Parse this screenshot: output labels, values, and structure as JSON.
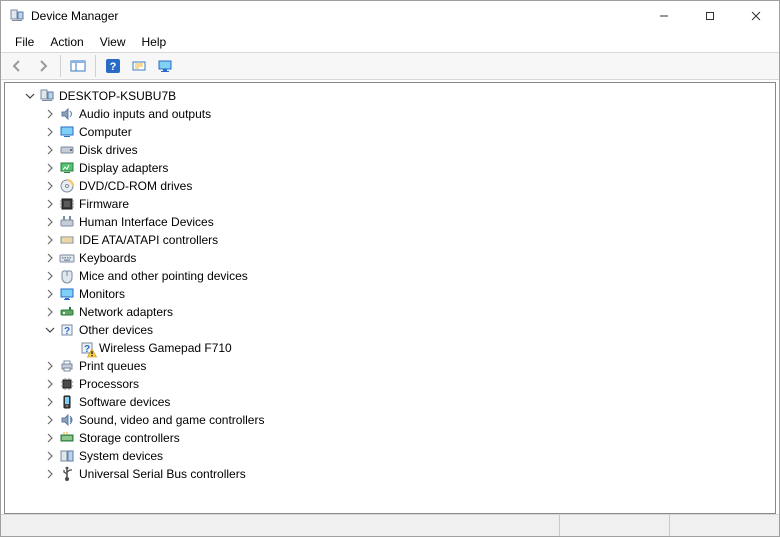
{
  "titlebar": {
    "title": "Device Manager"
  },
  "menu": {
    "file": "File",
    "action": "Action",
    "view": "View",
    "help": "Help"
  },
  "tree": {
    "root": "DESKTOP-KSUBU7B",
    "categories": [
      {
        "id": "audio",
        "label": "Audio inputs and outputs",
        "expanded": false
      },
      {
        "id": "computer",
        "label": "Computer",
        "expanded": false
      },
      {
        "id": "diskdrives",
        "label": "Disk drives",
        "expanded": false
      },
      {
        "id": "display",
        "label": "Display adapters",
        "expanded": false
      },
      {
        "id": "dvd",
        "label": "DVD/CD-ROM drives",
        "expanded": false
      },
      {
        "id": "firmware",
        "label": "Firmware",
        "expanded": false
      },
      {
        "id": "hid",
        "label": "Human Interface Devices",
        "expanded": false
      },
      {
        "id": "ide",
        "label": "IDE ATA/ATAPI controllers",
        "expanded": false
      },
      {
        "id": "keyboards",
        "label": "Keyboards",
        "expanded": false
      },
      {
        "id": "mice",
        "label": "Mice and other pointing devices",
        "expanded": false
      },
      {
        "id": "monitors",
        "label": "Monitors",
        "expanded": false
      },
      {
        "id": "network",
        "label": "Network adapters",
        "expanded": false
      },
      {
        "id": "other",
        "label": "Other devices",
        "expanded": true,
        "children": [
          {
            "id": "gamepad",
            "label": "Wireless Gamepad F710",
            "warning": true
          }
        ]
      },
      {
        "id": "printqueues",
        "label": "Print queues",
        "expanded": false
      },
      {
        "id": "processors",
        "label": "Processors",
        "expanded": false
      },
      {
        "id": "software",
        "label": "Software devices",
        "expanded": false
      },
      {
        "id": "sound",
        "label": "Sound, video and game controllers",
        "expanded": false
      },
      {
        "id": "storage",
        "label": "Storage controllers",
        "expanded": false
      },
      {
        "id": "system",
        "label": "System devices",
        "expanded": false
      },
      {
        "id": "usb",
        "label": "Universal Serial Bus controllers",
        "expanded": false
      }
    ]
  }
}
